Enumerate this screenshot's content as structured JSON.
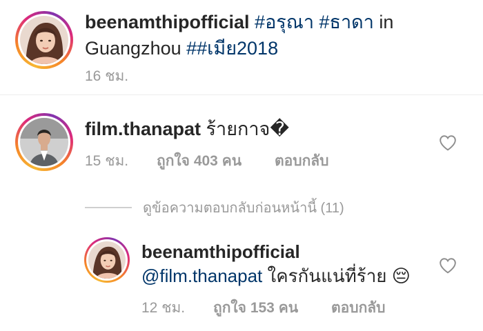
{
  "post": {
    "username": "beenamthipofficial",
    "tag1": "#อรุณา",
    "tag2": "#ธาดา",
    "in_text": "in",
    "location": "Guangzhou",
    "tag3": "##เมีย2018",
    "time": "16 ชม."
  },
  "comment": {
    "username": "film.thanapat",
    "text": "ร้ายกาจ�",
    "time": "15 ชม.",
    "likes": "ถูกใจ 403 คน",
    "reply_label": "ตอบกลับ",
    "heart_icon": "heart-outline-icon"
  },
  "view_replies": {
    "label": "ดูข้อความตอบกลับก่อนหน้านี้ (11)"
  },
  "reply": {
    "username": "beenamthipofficial",
    "mention": "@film.thanapat",
    "text": "ใครกันแน่ที่ร้าย",
    "emoji": "😔",
    "time": "12 ชม.",
    "likes": "ถูกใจ 153 คน",
    "reply_label": "ตอบกลับ",
    "heart_icon": "heart-outline-icon"
  },
  "colors": {
    "link": "#003569",
    "meta": "#999999",
    "text": "#262626"
  }
}
